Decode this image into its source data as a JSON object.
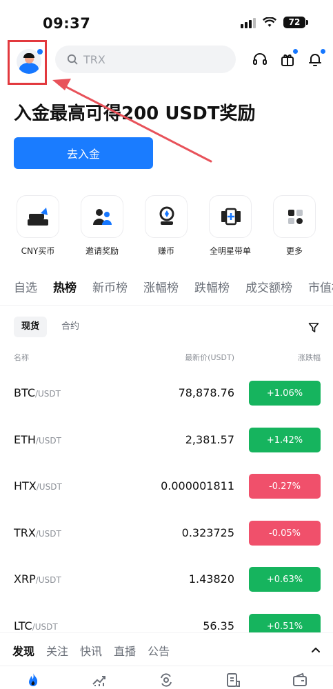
{
  "status_bar": {
    "time": "09:37",
    "battery": "72"
  },
  "search": {
    "placeholder": "TRX"
  },
  "banner": {
    "title": "入金最高可得200 USDT奖励",
    "button_label": "去入金"
  },
  "quick_actions": [
    {
      "label": "CNY买币",
      "icon": "cny-buy-icon"
    },
    {
      "label": "邀请奖励",
      "icon": "invite-icon"
    },
    {
      "label": "赚币",
      "icon": "earn-icon"
    },
    {
      "label": "全明星带单",
      "icon": "copy-trade-icon"
    },
    {
      "label": "更多",
      "icon": "more-icon"
    }
  ],
  "market_tabs": [
    "自选",
    "热榜",
    "新币榜",
    "涨幅榜",
    "跌幅榜",
    "成交额榜",
    "市值榜"
  ],
  "active_market_tab": "热榜",
  "sub_tabs": [
    "现货",
    "合约"
  ],
  "active_sub_tab": "现货",
  "columns": {
    "name": "名称",
    "price": "最新价(USDT)",
    "change": "涨跌幅"
  },
  "rows": [
    {
      "base": "BTC",
      "quote": "/USDT",
      "price": "78,878.76",
      "change": "+1.06%",
      "direction": "up"
    },
    {
      "base": "ETH",
      "quote": "/USDT",
      "price": "2,381.57",
      "change": "+1.42%",
      "direction": "up"
    },
    {
      "base": "HTX",
      "quote": "/USDT",
      "price": "0.000001811",
      "change": "-0.27%",
      "direction": "down"
    },
    {
      "base": "TRX",
      "quote": "/USDT",
      "price": "0.323725",
      "change": "-0.05%",
      "direction": "down"
    },
    {
      "base": "XRP",
      "quote": "/USDT",
      "price": "1.43820",
      "change": "+0.63%",
      "direction": "up"
    },
    {
      "base": "LTC",
      "quote": "/USDT",
      "price": "56.35",
      "change": "+0.51%",
      "direction": "up"
    }
  ],
  "news_tabs": [
    "发现",
    "关注",
    "快讯",
    "直播",
    "公告"
  ],
  "active_news_tab": "发现",
  "colors": {
    "accent": "#1677ff",
    "up": "#16b45e",
    "down": "#f0506b",
    "highlight": "#e2393e"
  }
}
